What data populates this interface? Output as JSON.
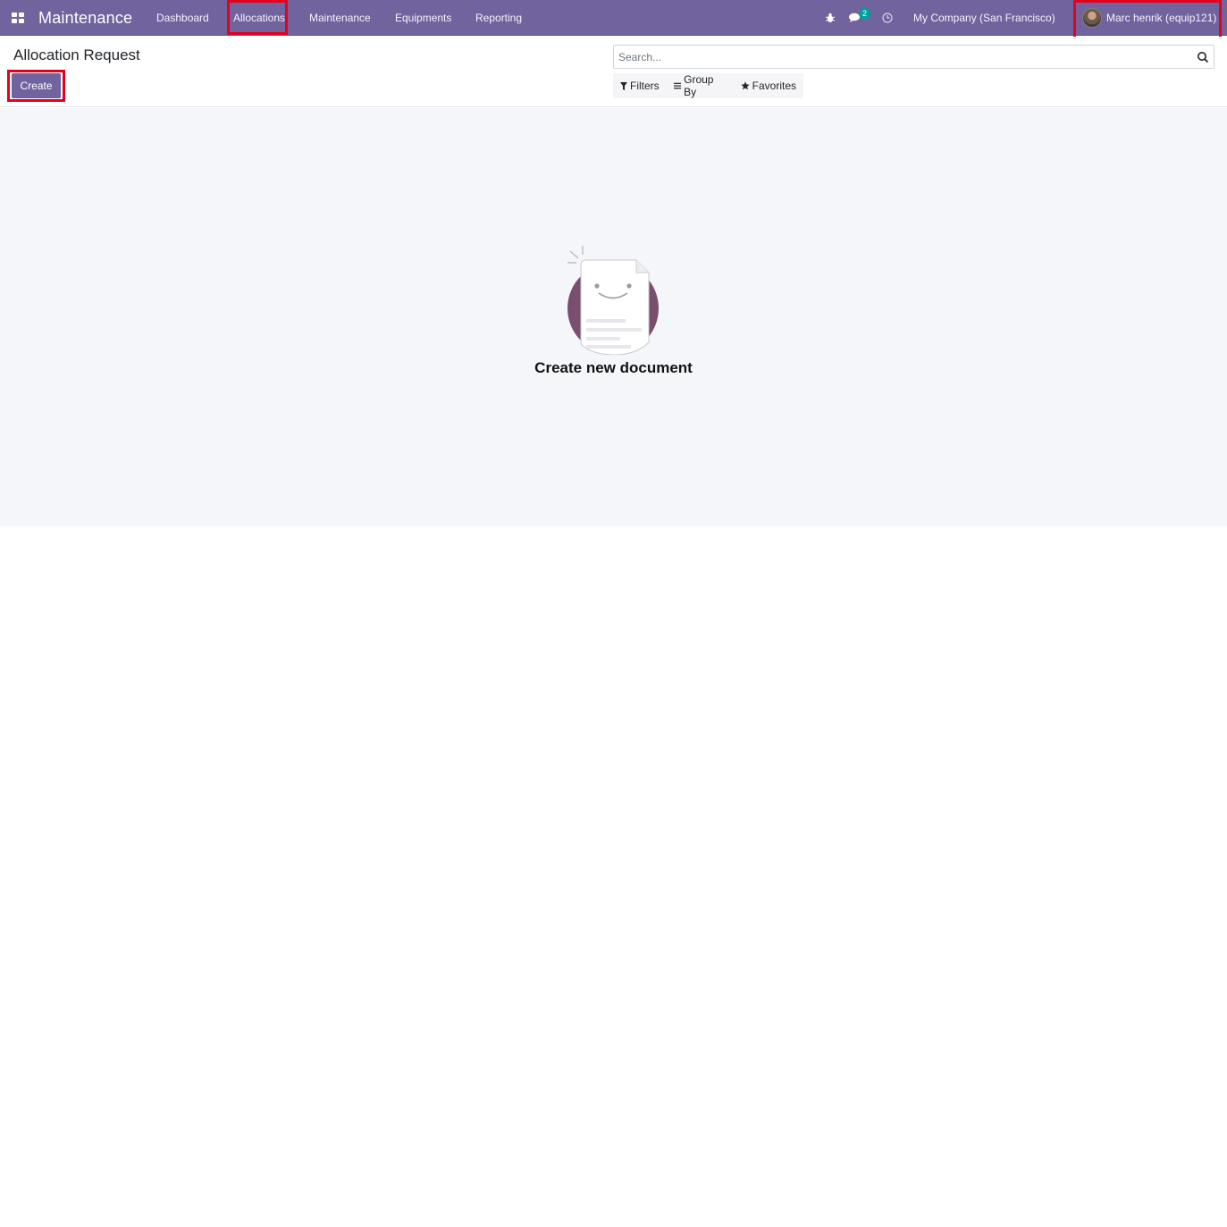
{
  "navbar": {
    "brand": "Maintenance",
    "menu": [
      {
        "label": "Dashboard"
      },
      {
        "label": "Allocations"
      },
      {
        "label": "Maintenance"
      },
      {
        "label": "Equipments"
      },
      {
        "label": "Reporting"
      }
    ],
    "messages_count": "2",
    "company": "My Company (San Francisco)",
    "user": "Marc henrik (equip121)"
  },
  "control_panel": {
    "breadcrumb": "Allocation Request",
    "create_label": "Create",
    "search_placeholder": "Search...",
    "filters_label": "Filters",
    "group_by_label": "Group By",
    "favorites_label": "Favorites"
  },
  "empty_state": {
    "title": "Create new document"
  },
  "colors": {
    "brand": "#71639e",
    "badge": "#00a09d",
    "highlight": "#e5001b",
    "illustration": "#7b4e6f"
  }
}
